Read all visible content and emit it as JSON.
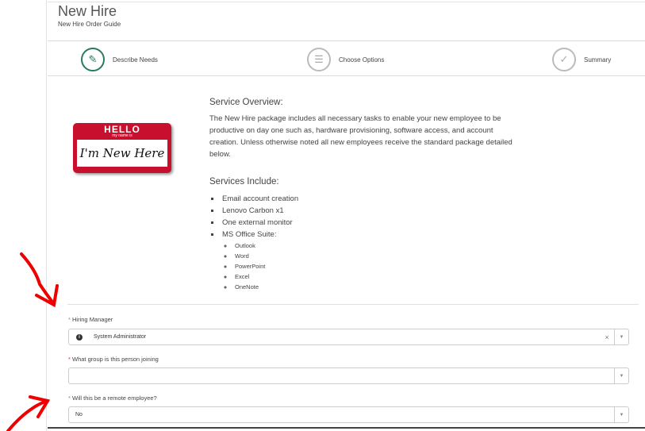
{
  "header": {
    "title": "New Hire",
    "subtitle": "New Hire Order Guide"
  },
  "steps": [
    {
      "label": "Describe Needs",
      "icon": "edit-icon",
      "active": true
    },
    {
      "label": "Choose Options",
      "icon": "list-icon",
      "active": false
    },
    {
      "label": "Summary",
      "icon": "check-icon",
      "active": false
    }
  ],
  "badge": {
    "hello": "HELLO",
    "my_name_is": "my name is",
    "name": "I'm New Here"
  },
  "overview": {
    "heading": "Service Overview:",
    "body": "The New Hire package includes all necessary tasks to enable your new employee to be productive on day one such as, hardware provisioning, software access, and account creation.  Unless otherwise noted all new employees receive the standard package detailed below.",
    "services_heading": "Services Include:",
    "services": [
      "Email account creation",
      "Lenovo Carbon x1",
      "One external monitor",
      "MS Office Suite:"
    ],
    "office_apps": [
      "Outlook",
      "Word",
      "PowerPoint",
      "Excel",
      "OneNote"
    ]
  },
  "form": {
    "hiring_manager": {
      "label": "Hiring Manager",
      "value": "System Administrator",
      "clear": "×",
      "info": "i"
    },
    "group": {
      "label": "What group is this person joining",
      "value": ""
    },
    "remote": {
      "label": "Will this be a remote employee?",
      "value": "No"
    },
    "star": "*",
    "caret": "▼"
  }
}
